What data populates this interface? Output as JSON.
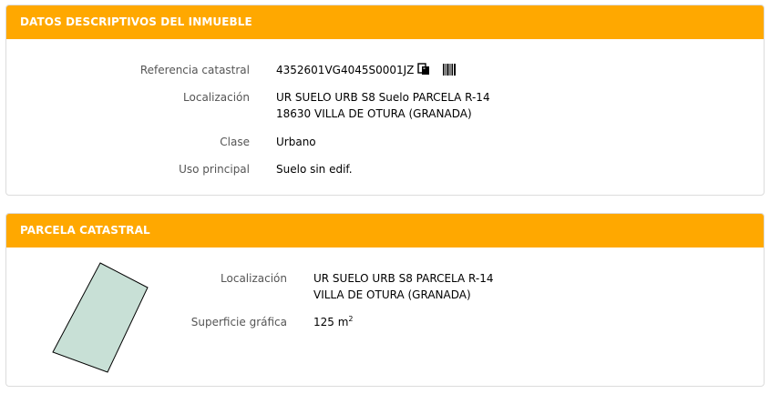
{
  "descriptive": {
    "title": "DATOS DESCRIPTIVOS DEL INMUEBLE",
    "referencia_label": "Referencia catastral",
    "referencia_value": "4352601VG4045S0001JZ",
    "localizacion_label": "Localización",
    "localizacion_line1": "UR SUELO URB S8 Suelo PARCELA R-14",
    "localizacion_line2": "18630 VILLA DE OTURA (GRANADA)",
    "clase_label": "Clase",
    "clase_value": "Urbano",
    "uso_label": "Uso principal",
    "uso_value": "Suelo sin edif."
  },
  "parcela": {
    "title": "PARCELA CATASTRAL",
    "localizacion_label": "Localización",
    "localizacion_line1": "UR SUELO URB S8 PARCELA R-14",
    "localizacion_line2": "VILLA DE OTURA (GRANADA)",
    "superficie_label": "Superficie gráfica",
    "superficie_value": "125 m",
    "superficie_unit_exp": "2",
    "parcel_fill_color": "#c8e0d6"
  },
  "icons": [
    "copy-icon",
    "barcode-icon"
  ]
}
